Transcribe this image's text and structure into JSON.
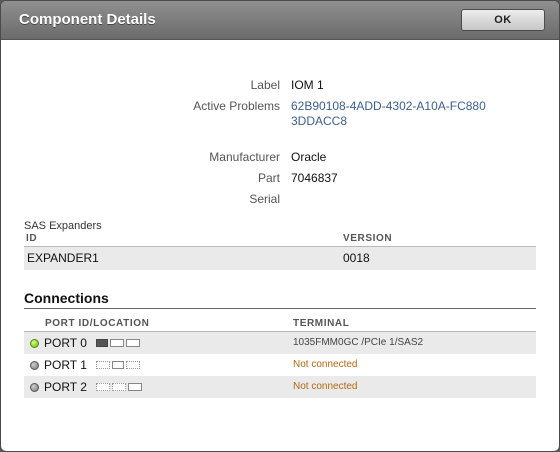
{
  "dialog": {
    "title": "Component Details",
    "ok_label": "OK"
  },
  "properties": {
    "label_caption": "Label",
    "label_value": "IOM 1",
    "problems_caption": "Active Problems",
    "problems_value": "62B90108-4ADD-4302-A10A-FC8803DDACC8",
    "manufacturer_caption": "Manufacturer",
    "manufacturer_value": "Oracle",
    "part_caption": "Part",
    "part_value": "7046837",
    "serial_caption": "Serial",
    "serial_value": ""
  },
  "sas_expanders": {
    "caption": "SAS Expanders",
    "columns": {
      "id": "ID",
      "version": "VERSION"
    },
    "rows": [
      {
        "id": "EXPANDER1",
        "version": "0018"
      }
    ]
  },
  "connections": {
    "heading": "Connections",
    "columns": {
      "port": "PORT ID/LOCATION",
      "terminal": "TERMINAL"
    },
    "rows": [
      {
        "port": "PORT 0",
        "status": "green",
        "terminal": "1035FMM0GC /PCIe 1/SAS2"
      },
      {
        "port": "PORT 1",
        "status": "gray",
        "terminal": "Not connected"
      },
      {
        "port": "PORT 2",
        "status": "gray",
        "terminal": "Not connected"
      }
    ]
  },
  "colors": {
    "link": "#3a5f8f",
    "not_connected": "#b06a10",
    "led_active": "#6bb010",
    "led_inactive": "#777777"
  }
}
